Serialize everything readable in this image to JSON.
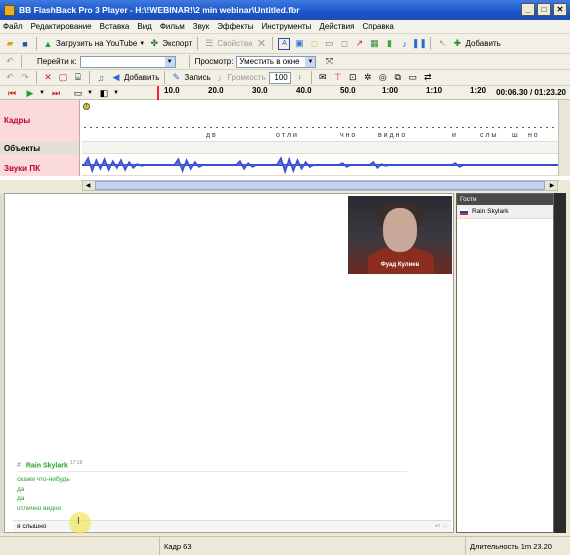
{
  "window": {
    "title": "BB FlashBack Pro 3 Player - H:\\!WEBINAR!\\2 min webinar\\Untitled.fbr",
    "buttons": {
      "minimize": "_",
      "maximize": "□",
      "close": "✕"
    }
  },
  "menu": [
    "Файл",
    "Редактирование",
    "Вставка",
    "Вид",
    "Фильм",
    "Звук",
    "Эффекты",
    "Инструменты",
    "Действия",
    "Справка"
  ],
  "toolbar1": {
    "upload_youtube": "Загрузить на YouTube",
    "export": "Экспорт",
    "properties": "Свойства",
    "add": "Добавить"
  },
  "toolbar2": {
    "goto_label": "Перейти к:",
    "goto_value": "",
    "view_label": "Просмотр:",
    "view_value": "Уместить в окне"
  },
  "toolbar3": {
    "add": "Добавить",
    "record": "Запись",
    "loudness": "Громкость",
    "volume_value": "100"
  },
  "ruler": {
    "ticks": [
      "10.0",
      "20.0",
      "30.0",
      "40.0",
      "50.0",
      "1:00",
      "1:10",
      "1:20"
    ],
    "position": "00:06.30",
    "duration": "01:23.20"
  },
  "tracks": {
    "frames": "Кадры",
    "objects": "Объекты",
    "audio": "Звуки ПК",
    "frame_letters": [
      "д в",
      "о т л и",
      "ч н о",
      "в и д н о",
      "и",
      "с л ы",
      "ш",
      "н о"
    ]
  },
  "recording": {
    "webcam_caption": "Фуад Кулиев",
    "chat": {
      "author": "Rain Skylark",
      "time": "17:19",
      "lines": [
        "скажи что-нибудь",
        "да",
        "да",
        "отлично видно"
      ],
      "input_text": "я слышно"
    },
    "guests": {
      "title": "Гости",
      "items": [
        "Rain Skylark"
      ]
    }
  },
  "status": {
    "frame": "Кадр 63",
    "duration": "Длительность 1m 23.20"
  }
}
